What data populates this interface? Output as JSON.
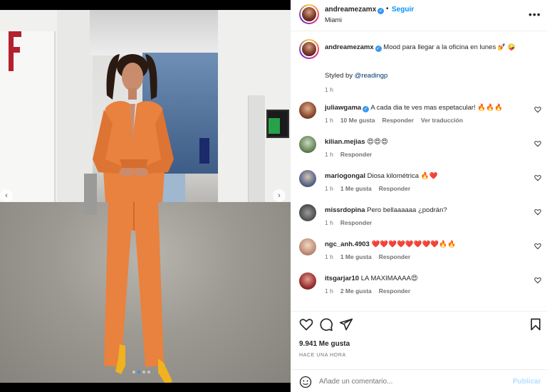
{
  "header": {
    "username": "andreamezamx",
    "follow_label": "Seguir",
    "location": "Miami",
    "dot": "•",
    "more_icon": "more-horizontal-icon"
  },
  "caption": {
    "username": "andreamezamx",
    "text": "Mood para llegar a la oficina en lunes",
    "emojis": "💅 🤪",
    "styled_by_prefix": "Styled by",
    "styled_by_mention": "@readingp",
    "time": "1 h"
  },
  "comments": [
    {
      "username": "juliawgama",
      "verified": true,
      "text": "A cada dia te ves mas espetacular! 🔥🔥🔥",
      "time": "1 h",
      "likes": "10 Me gusta",
      "reply": "Responder",
      "translate": "Ver traducción"
    },
    {
      "username": "kilian.mejias",
      "verified": false,
      "text": "😍😍😍",
      "time": "1 h",
      "likes": "",
      "reply": "Responder",
      "translate": ""
    },
    {
      "username": "mariogongal",
      "verified": false,
      "text": "Diosa kilométrica 🔥❤️",
      "time": "1 h",
      "likes": "1 Me gusta",
      "reply": "Responder",
      "translate": ""
    },
    {
      "username": "missrdopina",
      "verified": false,
      "text": "Pero bellaaaaaa ¿podrán?",
      "time": "1 h",
      "likes": "",
      "reply": "Responder",
      "translate": ""
    },
    {
      "username": "ngc_anh.4903",
      "verified": false,
      "text": "❤️❤️❤️❤️❤️❤️❤️❤️🔥🔥",
      "time": "1 h",
      "likes": "1 Me gusta",
      "reply": "Responder",
      "translate": ""
    },
    {
      "username": "itsgarjar10",
      "verified": false,
      "text": "LA MAXIMAAAA😍",
      "time": "1 h",
      "likes": "2 Me gusta",
      "reply": "Responder",
      "translate": ""
    }
  ],
  "actions": {
    "like_icon": "heart-icon",
    "comment_icon": "comment-icon",
    "share_icon": "share-icon",
    "save_icon": "bookmark-icon",
    "likes_count": "9.941 Me gusta",
    "post_time": "HACE UNA HORA"
  },
  "add_comment": {
    "placeholder": "Añade un comentario...",
    "publish_label": "Publicar"
  },
  "carousel": {
    "total": 4,
    "active": 2
  },
  "colors": {
    "accent": "#0095f6",
    "verified": "#3897f0",
    "suit": "#e9813f",
    "muted": "#737373"
  }
}
